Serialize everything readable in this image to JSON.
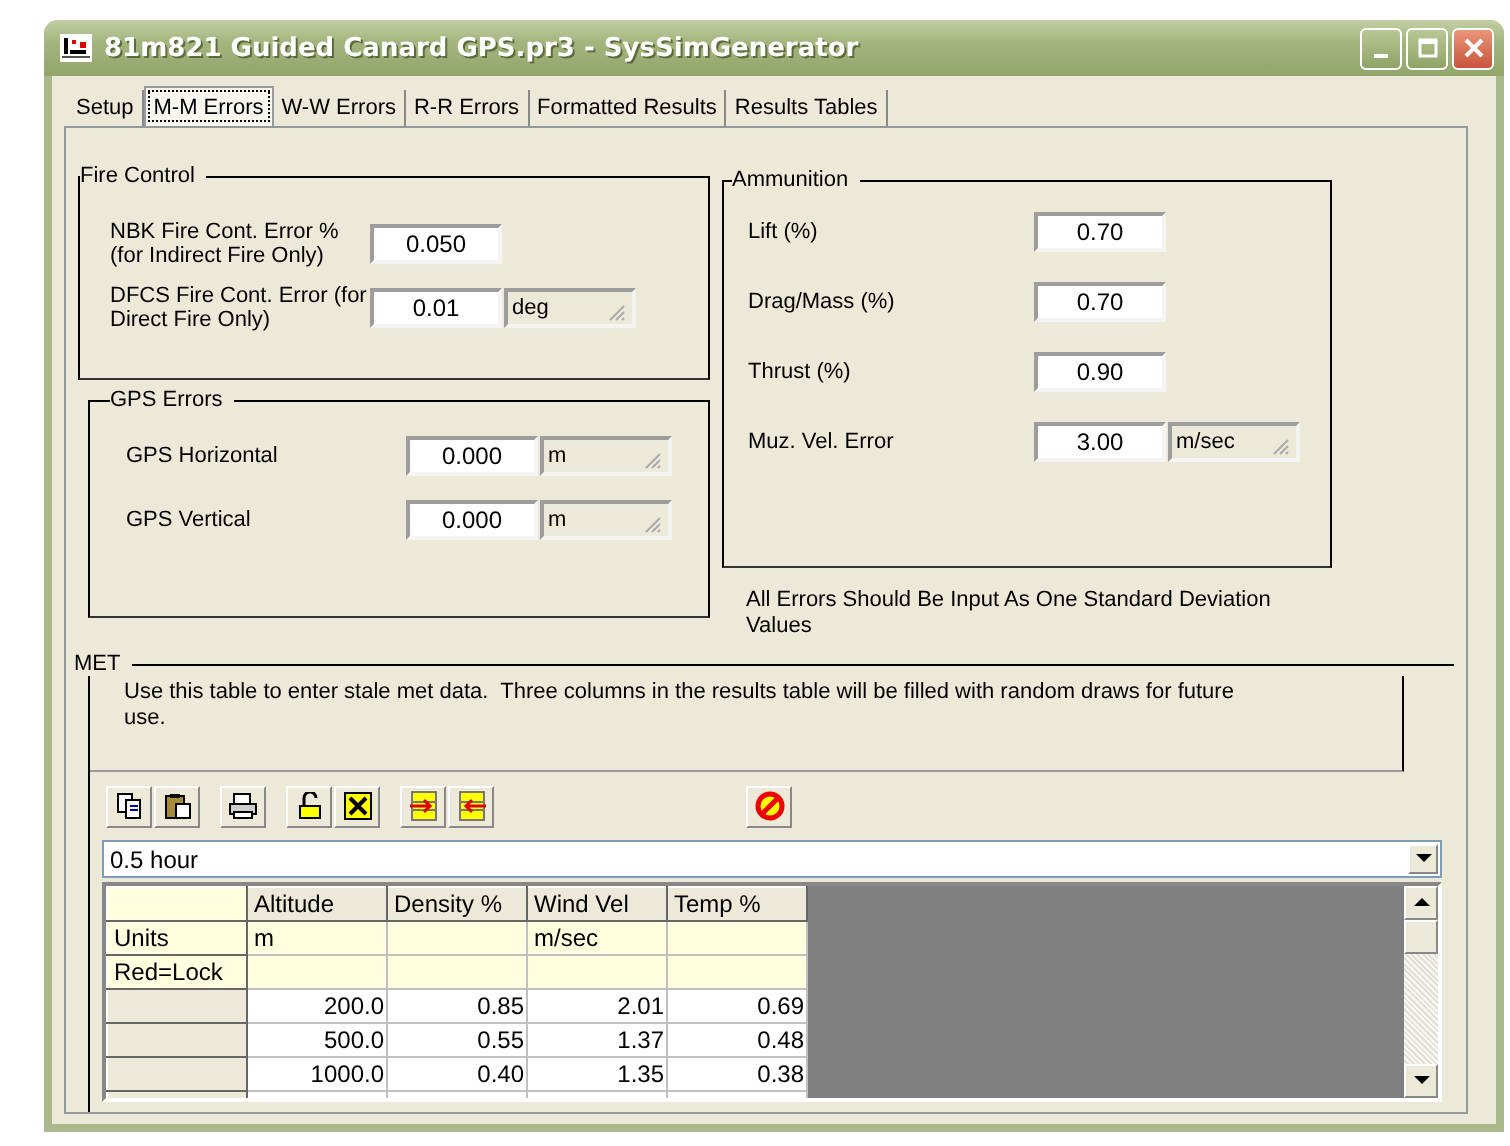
{
  "window": {
    "title": "81m821 Guided Canard GPS.pr3 - SysSimGenerator"
  },
  "tabs": [
    {
      "label": "Setup",
      "selected": false
    },
    {
      "label": "M-M Errors",
      "selected": true
    },
    {
      "label": "W-W Errors",
      "selected": false
    },
    {
      "label": "R-R Errors",
      "selected": false
    },
    {
      "label": "Formatted Results",
      "selected": false
    },
    {
      "label": "Results Tables",
      "selected": false
    }
  ],
  "fire_control": {
    "title": "Fire Control",
    "fields": [
      {
        "label": "NBK Fire Cont. Error % (for Indirect Fire Only)",
        "value": "0.050"
      },
      {
        "label": "DFCS Fire Cont. Error (for Direct Fire Only)",
        "value": "0.01",
        "unit": "deg"
      }
    ]
  },
  "gps_errors": {
    "title": "GPS Errors",
    "fields": [
      {
        "label": "GPS Horizontal",
        "value": "0.000",
        "unit": "m"
      },
      {
        "label": "GPS Vertical",
        "value": "0.000",
        "unit": "m"
      }
    ]
  },
  "ammunition": {
    "title": "Ammunition",
    "fields": [
      {
        "label": "Lift (%)",
        "value": "0.70"
      },
      {
        "label": "Drag/Mass (%)",
        "value": "0.70"
      },
      {
        "label": "Thrust (%)",
        "value": "0.90"
      },
      {
        "label": "Muz. Vel. Error",
        "value": "3.00",
        "unit": "m/sec"
      }
    ]
  },
  "note": "All Errors Should Be Input As One Standard Deviation Values",
  "met": {
    "title": "MET",
    "description": "Use this table to enter stale met data.  Three columns in the results table will be filled with random draws for future use.",
    "period": {
      "value": "0.5 hour"
    },
    "table": {
      "columns": [
        "Altitude",
        "Density %",
        "Wind Vel",
        "Temp %"
      ],
      "rows": [
        {
          "kind": "meta",
          "header": "Units",
          "cells": [
            "m",
            null,
            "m/sec",
            null
          ]
        },
        {
          "kind": "meta",
          "header": "Red=Lock",
          "cells": [
            null,
            null,
            null,
            null
          ]
        },
        {
          "kind": "data",
          "cells": [
            "200.0",
            "0.85",
            "2.01",
            "0.69"
          ]
        },
        {
          "kind": "data",
          "cells": [
            "500.0",
            "0.55",
            "1.37",
            "0.48"
          ]
        },
        {
          "kind": "data",
          "cells": [
            "1000.0",
            "0.40",
            "1.35",
            "0.38"
          ]
        },
        {
          "kind": "data",
          "cells": [
            null,
            null,
            null,
            null
          ]
        }
      ]
    }
  }
}
